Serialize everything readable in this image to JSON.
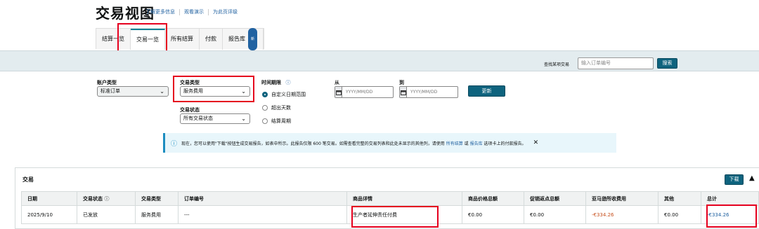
{
  "page": {
    "title": "交易视图",
    "links": [
      "了解更多信息",
      "观看演示",
      "为此页评级"
    ]
  },
  "tabs": [
    {
      "label": "结算一览"
    },
    {
      "label": "交易一览"
    },
    {
      "label": "所有结算"
    },
    {
      "label": "付款"
    },
    {
      "label": "报告库",
      "badge": "新"
    }
  ],
  "search": {
    "label": "查找某项交易",
    "placeholder": "输入订单编号",
    "button": "搜索"
  },
  "filters": {
    "account_type_label": "账户类型",
    "account_type_value": "标准订单",
    "txn_type_label": "交易类型",
    "txn_type_value": "服务费用",
    "txn_status_label": "交易状态",
    "txn_status_value": "所有交易状态",
    "time_label": "时间期限",
    "time_options": [
      "自定义日期范围",
      "超出天数",
      "结算周期"
    ],
    "from_label": "从",
    "to_label": "到",
    "date_placeholder": "YYYY/MM/DD",
    "update_button": "更新"
  },
  "info": {
    "text_before": "现在，您可以使用\"下载\"按钮生成交易报告，如表中所示。此报告仅限 600 笔交易。如需查看完整的交易列表和此处未显示的其他列，请使用",
    "link1": "所有结算",
    "mid": "或",
    "link2": "报告库",
    "text_after": "选项卡上的付款报告。"
  },
  "table": {
    "title": "交易",
    "download": "下载",
    "headers": [
      "日期",
      "交易状态",
      "交易类型",
      "订单编号",
      "商品详情",
      "商品价格总额",
      "促销返点总额",
      "亚马逊所收费用",
      "其他",
      "总计"
    ],
    "rows": [
      [
        "2025/9/10",
        "已发放",
        "服务费用",
        "---",
        "生产者延伸责任付费",
        "€0.00",
        "€0.00",
        "-€334.26",
        "€0.00",
        "-€334.26"
      ]
    ]
  },
  "colors": {
    "accent": "#0e637e",
    "highlight": "#e5001e",
    "negative": "#c7511f"
  }
}
